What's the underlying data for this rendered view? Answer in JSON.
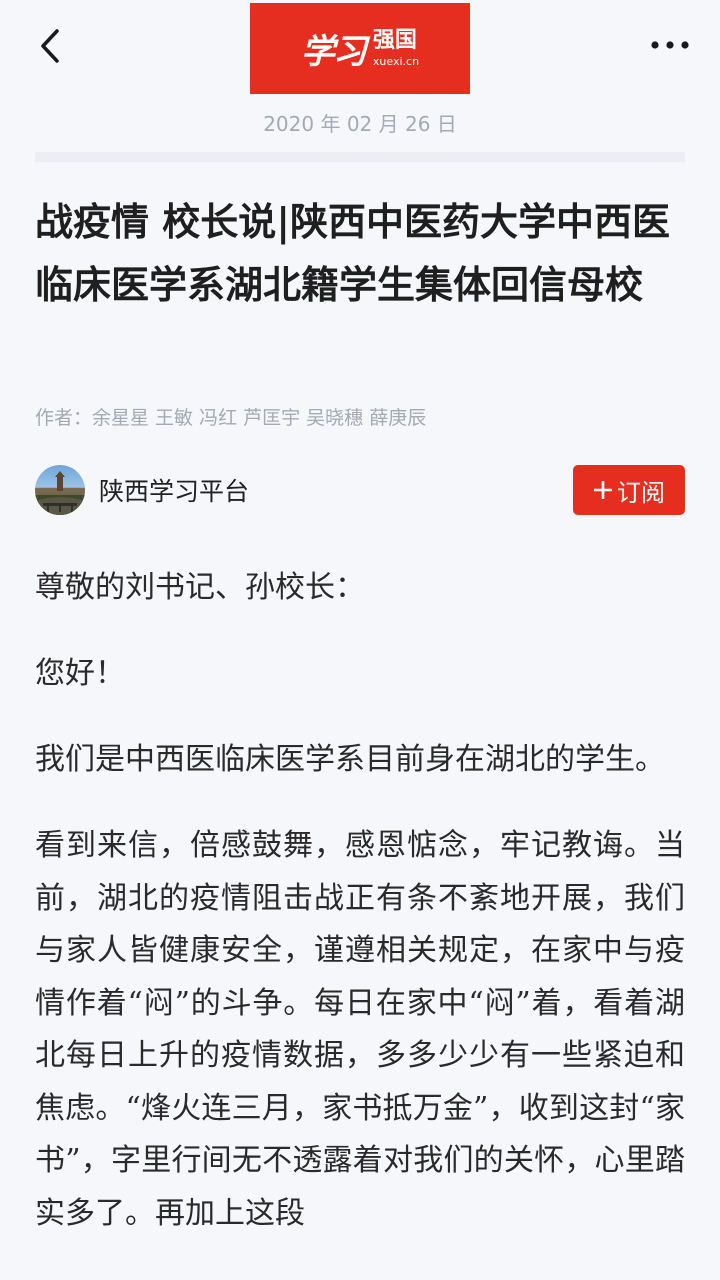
{
  "header": {
    "back_icon": "chevron-left-icon",
    "logo_script": "学习",
    "logo_cn": "强国",
    "logo_url": "xuexi.cn",
    "more_icon": "more-dots-icon",
    "brand_color": "#e52d20"
  },
  "article": {
    "date": "2020 年 02 月 26 日",
    "title": "战疫情 校长说|陕西中医药大学中西医临床医学系湖北籍学生集体回信母校",
    "author": "作者：余星星 王敏 冯红 芦匡宇 吴晓穗 薛庚辰",
    "source": {
      "name": "陕西学习平台",
      "subscribe_label": "订阅",
      "subscribe_icon": "plus-icon"
    },
    "paragraphs": [
      "尊敬的刘书记、孙校长：",
      "您好！",
      "我们是中西医临床医学系目前身在湖北的学生。",
      "看到来信，倍感鼓舞，感恩惦念，牢记教诲。当前，湖北的疫情阻击战正有条不紊地开展，我们与家人皆健康安全，谨遵相关规定，在家中与疫情作着“闷”的斗争。每日在家中“闷”着，看着湖北每日上升的疫情数据，多多少少有一些紧迫和焦虑。“烽火连三月，家书抵万金”，收到这封“家书”，字里行间无不透露着对我们的关怀，心里踏实多了。再加上这段"
    ]
  }
}
